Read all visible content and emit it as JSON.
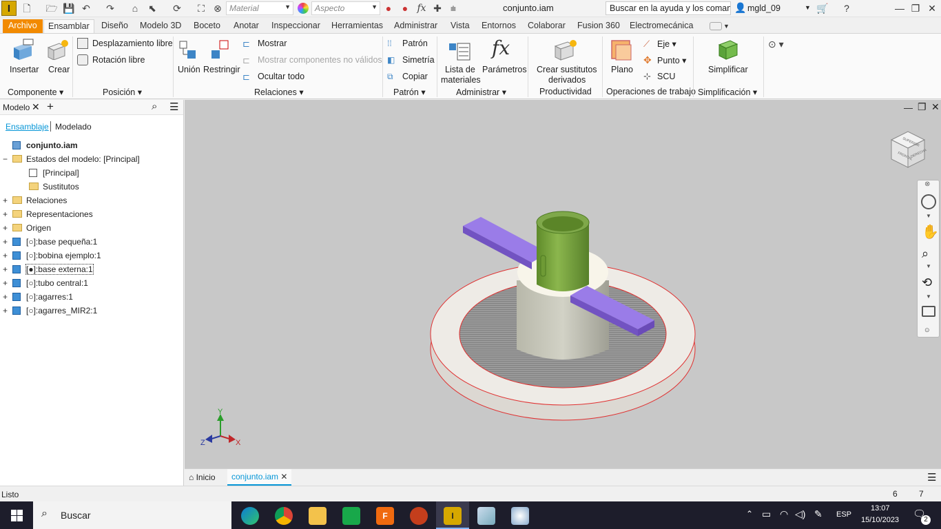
{
  "app": {
    "logo_letter": "I",
    "title": "conjunto.iam",
    "material_placeholder": "Material",
    "appearance_placeholder": "Aspecto",
    "help_search": "Buscar en la ayuda y los comanc",
    "user": "mgld_09"
  },
  "tabs": [
    "Archivo",
    "Ensamblar",
    "Diseño",
    "Modelo 3D",
    "Boceto",
    "Anotar",
    "Inspeccionar",
    "Herramientas",
    "Administrar",
    "Vista",
    "Entornos",
    "Colaborar",
    "Fusion 360",
    "Electromecánica"
  ],
  "ribbon": {
    "componente": {
      "insertar": "Insertar",
      "crear": "Crear",
      "group": "Componente"
    },
    "posicion": {
      "desplazamiento": "Desplazamiento libre",
      "rotacion": "Rotación libre",
      "group": "Posición"
    },
    "relaciones": {
      "union": "Unión",
      "restringir": "Restringir",
      "mostrar": "Mostrar",
      "mostrar_no_validos": "Mostrar componentes no válidos",
      "ocultar_todo": "Ocultar todo",
      "group": "Relaciones"
    },
    "patron": {
      "patron": "Patrón",
      "simetria": "Simetría",
      "copiar": "Copiar",
      "group": "Patrón"
    },
    "administrar": {
      "lista1": "Lista de",
      "lista2": "materiales",
      "parametros": "Parámetros",
      "group": "Administrar"
    },
    "productividad": {
      "crear1": "Crear sustitutos",
      "crear2": "derivados",
      "group": "Productividad"
    },
    "operaciones": {
      "plano": "Plano",
      "eje": "Eje",
      "punto": "Punto",
      "scu": "SCU",
      "group": "Operaciones de trabajo"
    },
    "simplificacion": {
      "simplificar": "Simplificar",
      "group": "Simplificación"
    }
  },
  "panel": {
    "title": "Modelo",
    "tab_ensamblaje": "Ensamblaje",
    "tab_modelado": "Modelado",
    "tree": [
      {
        "label": "conjunto.iam",
        "indent": 0,
        "icon": "assembly",
        "bold": true,
        "expander": ""
      },
      {
        "label": "Estados del modelo: [Principal]",
        "indent": 0,
        "icon": "folder-open",
        "expander": "−"
      },
      {
        "label": "[Principal]",
        "indent": 2,
        "icon": "check-state",
        "expander": ""
      },
      {
        "label": "Sustitutos",
        "indent": 2,
        "icon": "folder",
        "expander": ""
      },
      {
        "label": "Relaciones",
        "indent": 0,
        "icon": "folder",
        "expander": "+"
      },
      {
        "label": "Representaciones",
        "indent": 0,
        "icon": "folder-rep",
        "expander": "+"
      },
      {
        "label": "Origen",
        "indent": 0,
        "icon": "folder",
        "expander": "+"
      },
      {
        "label": "[○]:base pequeña:1",
        "indent": 0,
        "icon": "part",
        "expander": "+"
      },
      {
        "label": "[○]:bobina ejemplo:1",
        "indent": 0,
        "icon": "part",
        "expander": "+"
      },
      {
        "label": "[●]:base externa:1",
        "indent": 0,
        "icon": "part-edit",
        "expander": "+"
      },
      {
        "label": "[○]:tubo central:1",
        "indent": 0,
        "icon": "part",
        "expander": "+"
      },
      {
        "label": "[○]:agarres:1",
        "indent": 0,
        "icon": "part",
        "expander": "+"
      },
      {
        "label": "[○]:agarres_MIR2:1",
        "indent": 0,
        "icon": "part",
        "expander": "+"
      }
    ]
  },
  "viewcube": {
    "face_front": "FRONTAL",
    "face_right": "DERECHA",
    "face_top": "SUPERIOR"
  },
  "axes": {
    "x": "X",
    "y": "Y",
    "z": "Z"
  },
  "doctabs": {
    "home": "Inicio",
    "doc": "conjunto.iam"
  },
  "status": {
    "text": "Listo",
    "n1": "6",
    "n2": "7"
  },
  "taskbar": {
    "search": "Buscar",
    "lang": "ESP",
    "time": "13:07",
    "date": "15/10/2023",
    "notif": "2"
  },
  "colors": {
    "accent": "#f28a00",
    "selection": "#0696d7",
    "green_part": "#6e9a35",
    "purple_part": "#9070e0"
  }
}
